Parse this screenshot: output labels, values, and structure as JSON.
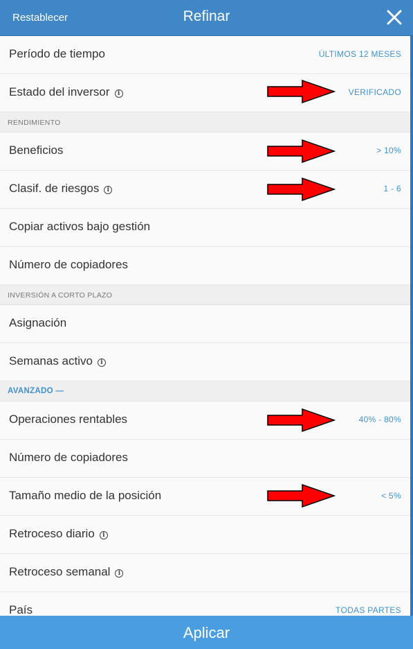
{
  "header": {
    "reset_label": "Restablecer",
    "title": "Refinar",
    "close_icon": "close-icon"
  },
  "rows_top": [
    {
      "label": "Período de tiempo",
      "value": "ÚLTIMOS 12 MESES"
    },
    {
      "label": "Estado del inversor",
      "value": "VERIFICADO",
      "info": true
    }
  ],
  "sections": {
    "rendimiento": "RENDIMIENTO",
    "corto_plazo": "INVERSIÓN A CORTO PLAZO",
    "avanzado": "AVANZADO —"
  },
  "rows_rendimiento": [
    {
      "label": "Beneficios",
      "value": "> 10%"
    },
    {
      "label": "Clasif. de riesgos",
      "value": "1 - 6",
      "info": true
    },
    {
      "label": "Copiar activos bajo gestión",
      "value": ""
    },
    {
      "label": "Número de copiadores",
      "value": ""
    }
  ],
  "rows_corto_plazo": [
    {
      "label": "Asignación",
      "value": ""
    },
    {
      "label": "Semanas activo",
      "value": "",
      "info": true
    }
  ],
  "rows_avanzado": [
    {
      "label": "Operaciones rentables",
      "value": "40% - 80%"
    },
    {
      "label": "Número de copiadores",
      "value": ""
    },
    {
      "label": "Tamaño medio de la posición",
      "value": "< 5%"
    },
    {
      "label": "Retroceso diario",
      "value": "",
      "info": true
    },
    {
      "label": "Retroceso semanal",
      "value": "",
      "info": true
    },
    {
      "label": "País",
      "value": "TODAS PARTES"
    }
  ],
  "info_glyph": "i",
  "footer": {
    "apply_label": "Aplicar"
  },
  "colors": {
    "header_bg": "#3f87c6",
    "footer_bg": "#4a9ee0",
    "accent": "#3f92cf",
    "annotation_arrow": "#ff0000"
  }
}
